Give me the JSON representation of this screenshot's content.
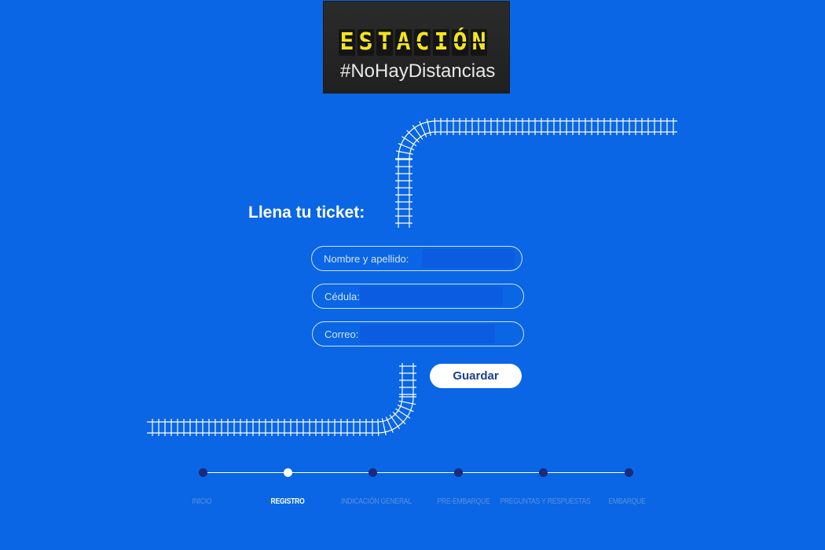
{
  "logo": {
    "letters": [
      "E",
      "S",
      "T",
      "A",
      "C",
      "I",
      "Ó",
      "N"
    ],
    "subtitle": "#NoHayDistancias"
  },
  "form": {
    "title": "Llena tu ticket:",
    "fields": [
      {
        "label": "Nombre y apellido:"
      },
      {
        "label": "Cédula:"
      },
      {
        "label": "Correo:"
      }
    ],
    "save_label": "Guardar"
  },
  "steps": [
    {
      "label": "INICIO",
      "active": false
    },
    {
      "label": "REGISTRO",
      "active": true
    },
    {
      "label": "INDICACIÓN GENERAL",
      "active": false
    },
    {
      "label": "PRE-EMBARQUE",
      "active": false
    },
    {
      "label": "PREGUNTAS Y RESPUESTAS",
      "active": false
    },
    {
      "label": "EMBARQUE",
      "active": false
    }
  ],
  "colors": {
    "background": "#0a66e4",
    "logo_letters": "#f4e51e",
    "step_dot": "#1b2a7a",
    "step_dot_active": "#ffffff",
    "button_text": "#1d3f8f"
  }
}
